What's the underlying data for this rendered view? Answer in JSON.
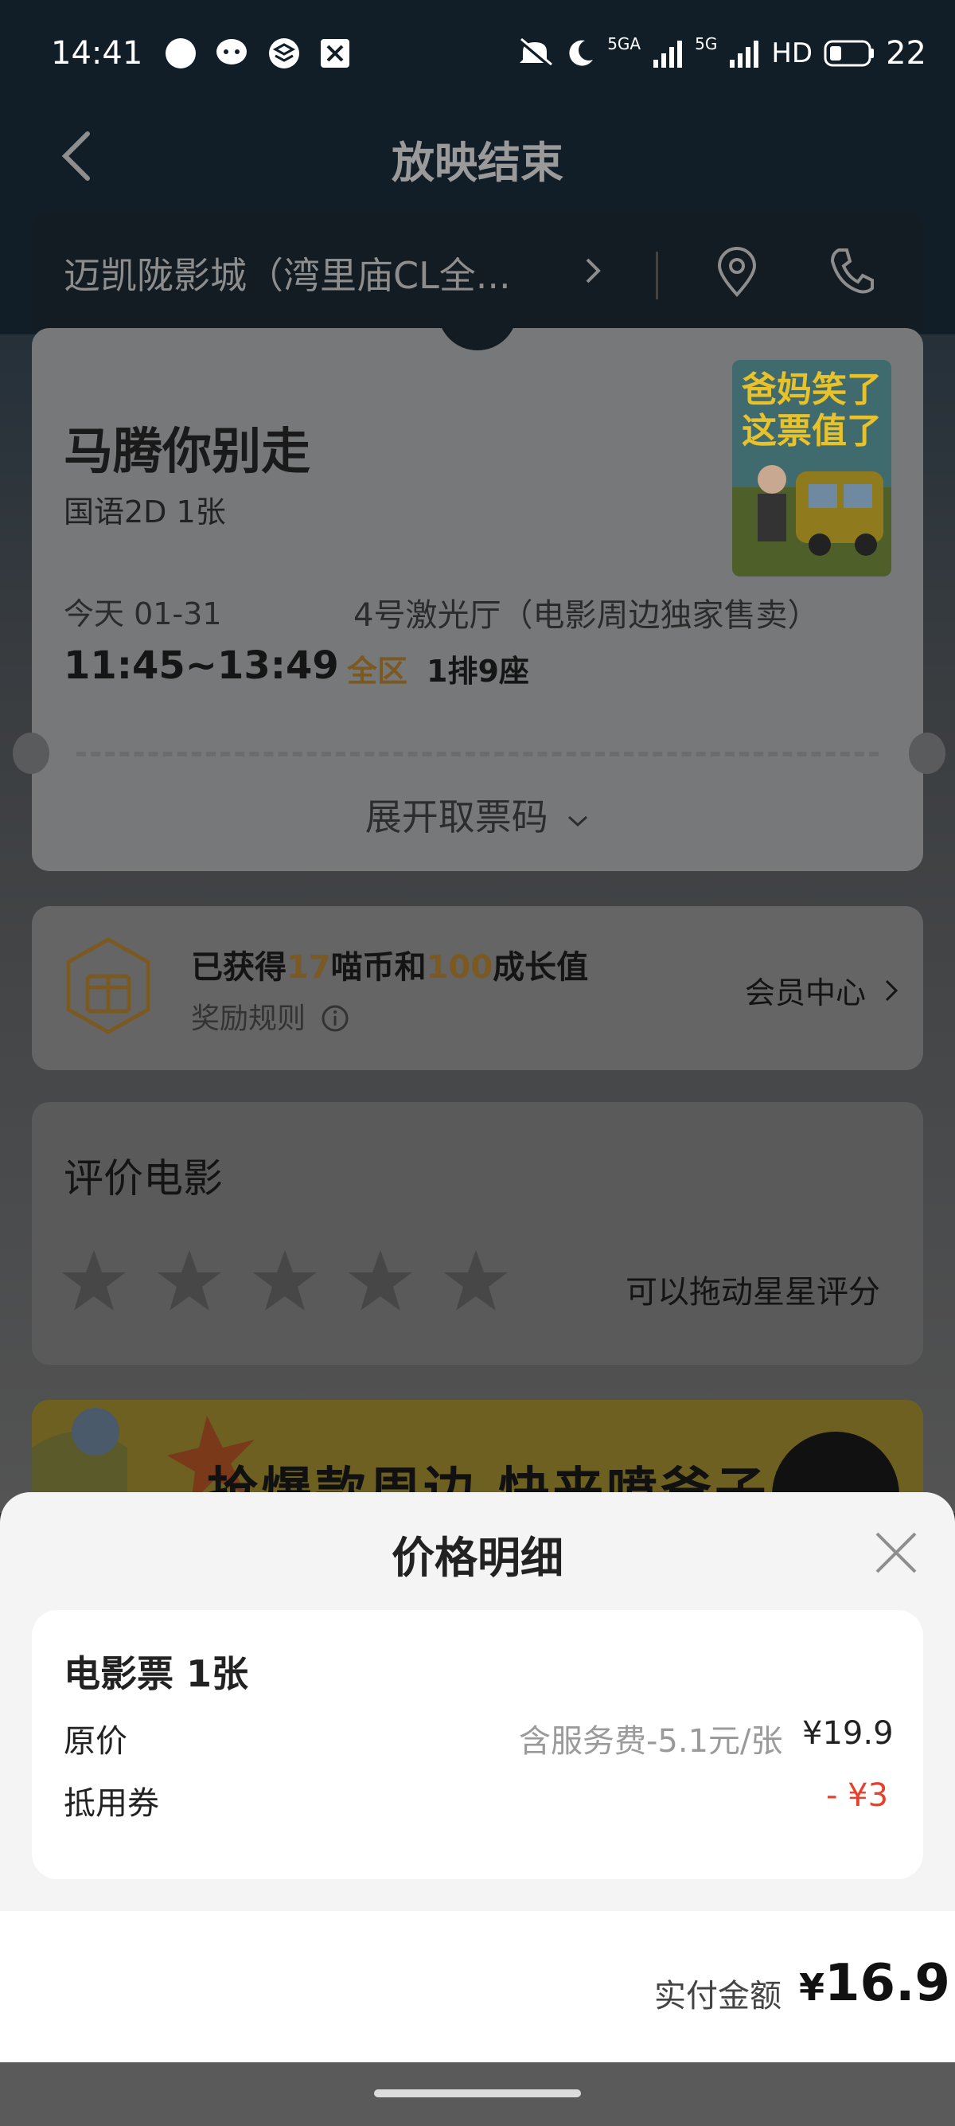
{
  "status_bar": {
    "time": "14:41",
    "network": "5GA",
    "network2": "5G",
    "hd": "HD",
    "battery": "22"
  },
  "header": {
    "title": "放映结束"
  },
  "cinema": {
    "name": "迈凯陇影城（湾里庙CL全..."
  },
  "movie": {
    "title": "马腾你别走",
    "format": "国语2D 1张",
    "date": "今天 01-31",
    "time_range": "11:45~13:49",
    "hall": "4号激光厅（电影周边独家售卖）",
    "zone": "全区",
    "seat": "1排9座",
    "poster_text": [
      "爸妈笑了",
      "这票值了"
    ],
    "expand_label": "展开取票码"
  },
  "reward": {
    "prefix": "已获得",
    "coins": "17",
    "mid": "喵币和",
    "growth": "100",
    "suffix": "成长值",
    "rule": "奖励规则",
    "member_center": "会员中心"
  },
  "rating": {
    "title": "评价电影",
    "hint": "可以拖动星星评分",
    "stars": 0,
    "max_stars": 5
  },
  "banner": {
    "text": "抢爆款周边 快来喷爸子!"
  },
  "price_sheet": {
    "title": "价格明细",
    "item_title": "电影票 1张",
    "original_label": "原价",
    "service_note": "含服务费-5.1元/张",
    "original_price": "¥19.9",
    "coupon_label": "抵用券",
    "coupon_amount": "- ¥3",
    "paid_label": "实付金额",
    "paid_currency": "¥",
    "paid_amount": "16.9"
  },
  "colors": {
    "accent_gold": "#d49a3a",
    "discount_red": "#e8402e"
  }
}
